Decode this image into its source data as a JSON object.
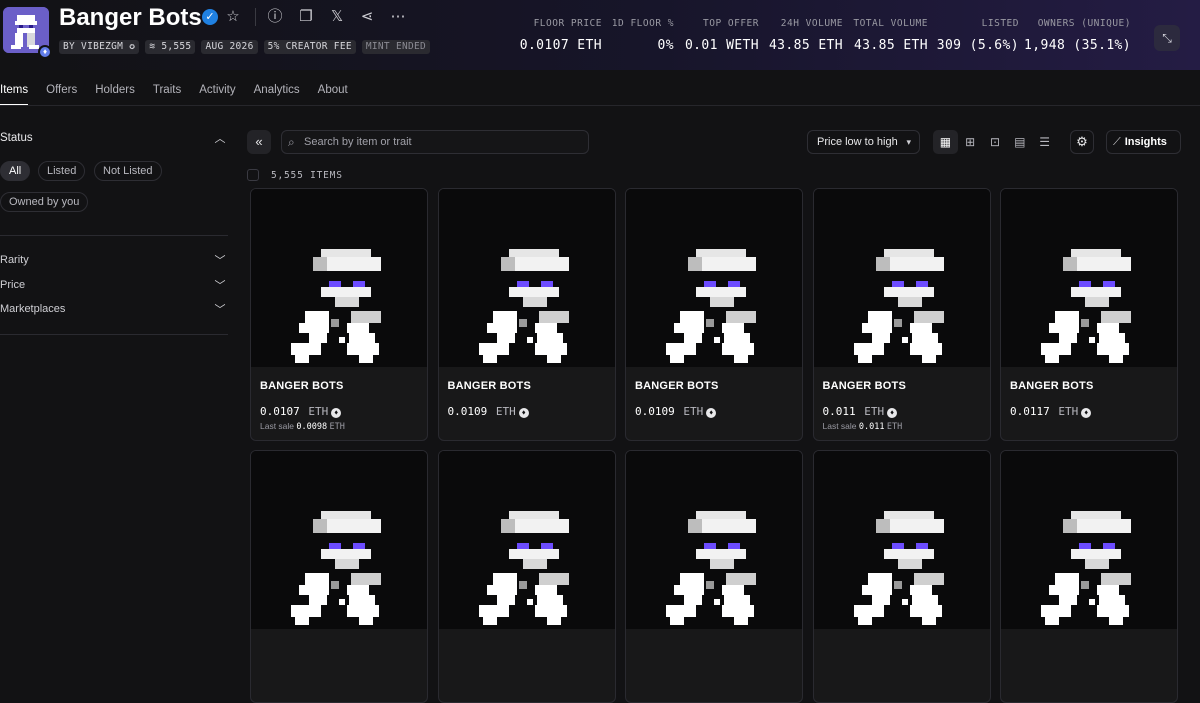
{
  "collection": {
    "title": "Banger Bots",
    "creator_tag": "BY VIBEZGM",
    "supply_tag": "5,555",
    "date_tag": "AUG 2026",
    "fee_tag": "5% CREATOR FEE",
    "mint_tag": "MINT ENDED"
  },
  "stats": [
    {
      "label": "FLOOR PRICE",
      "value": "0.0107 ETH"
    },
    {
      "label": "1D FLOOR %",
      "value": "0%"
    },
    {
      "label": "TOP OFFER",
      "value": "0.01 WETH"
    },
    {
      "label": "24H VOLUME",
      "value": "43.85 ETH"
    },
    {
      "label": "TOTAL VOLUME",
      "value": "43.85 ETH"
    },
    {
      "label": "LISTED",
      "value": "309 (5.6%)"
    },
    {
      "label": "OWNERS (UNIQUE)",
      "value": "1,948 (35.1%)"
    }
  ],
  "tabs": [
    "Items",
    "Offers",
    "Holders",
    "Traits",
    "Activity",
    "Analytics",
    "About"
  ],
  "sidebar": {
    "status_title": "Status",
    "status_options": [
      "All",
      "Listed",
      "Not Listed",
      "Owned by you"
    ],
    "sections": [
      "Rarity",
      "Price",
      "Marketplaces"
    ]
  },
  "toolbar": {
    "search_placeholder": "Search by item or trait",
    "sort_label": "Price low to high",
    "insights_label": "Insights",
    "item_count": "5,555 ITEMS"
  },
  "cards": [
    {
      "name": "BANGER BOTS",
      "price": "0.0107",
      "currency": "ETH",
      "last_sale_label": "Last sale",
      "last_sale_value": "0.0098",
      "last_sale_currency": "ETH"
    },
    {
      "name": "BANGER BOTS",
      "price": "0.0109",
      "currency": "ETH"
    },
    {
      "name": "BANGER BOTS",
      "price": "0.0109",
      "currency": "ETH"
    },
    {
      "name": "BANGER BOTS",
      "price": "0.011",
      "currency": "ETH",
      "last_sale_label": "Last sale",
      "last_sale_value": "0.011",
      "last_sale_currency": "ETH"
    },
    {
      "name": "BANGER BOTS",
      "price": "0.0117",
      "currency": "ETH"
    },
    {
      "name": "",
      "price": "",
      "currency": ""
    },
    {
      "name": "",
      "price": "",
      "currency": ""
    },
    {
      "name": "",
      "price": "",
      "currency": ""
    },
    {
      "name": "",
      "price": "",
      "currency": ""
    },
    {
      "name": "",
      "price": "",
      "currency": ""
    }
  ],
  "colors": {
    "accent_purple": "#6c4cff",
    "verified_blue": "#2081e2",
    "eth_blue": "#627eea"
  }
}
